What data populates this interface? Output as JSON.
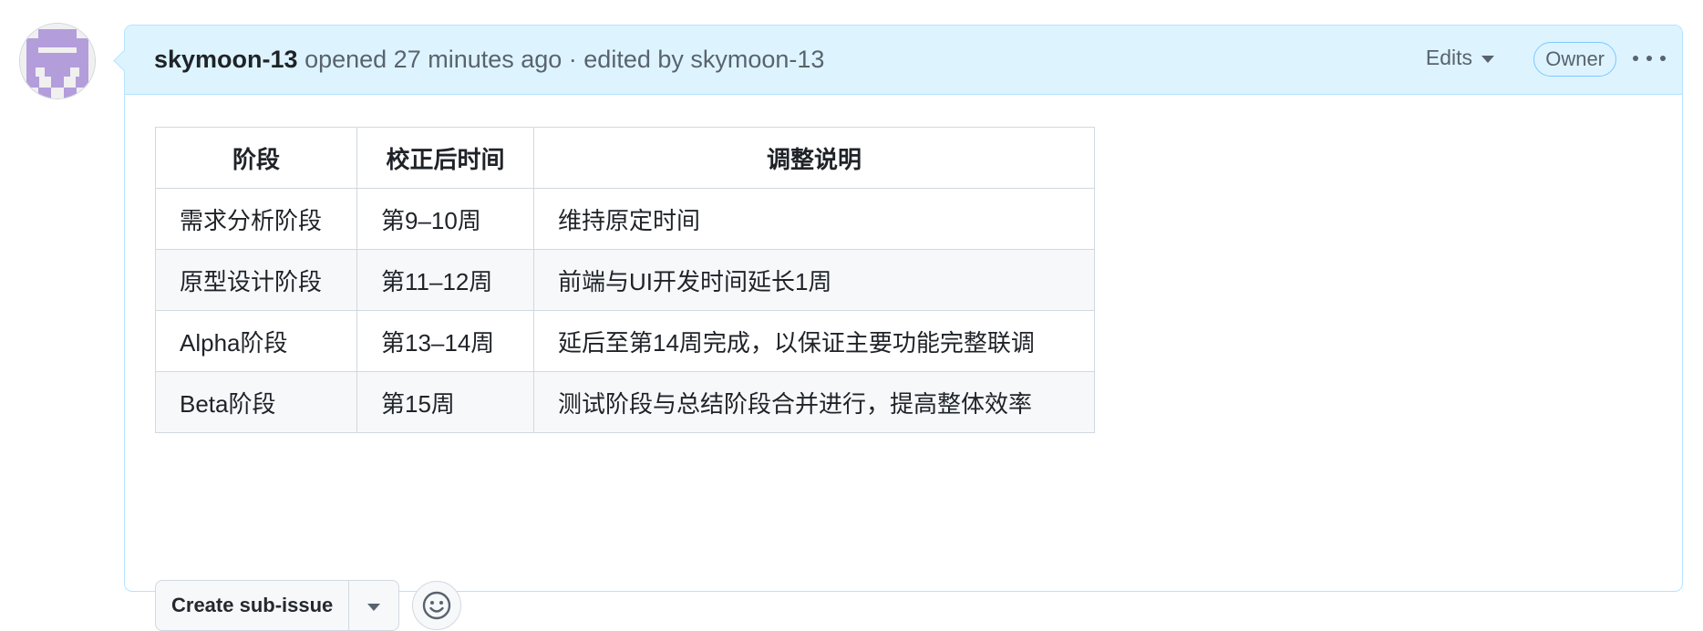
{
  "comment": {
    "author": "skymoon-13",
    "opened_text": "opened 27 minutes ago · edited by skymoon-13",
    "edits_label": "Edits",
    "owner_badge": "Owner",
    "more_icon": "kebab-horizontal-icon"
  },
  "avatar": {
    "icon": "identicon",
    "color": "#b39ddb"
  },
  "table": {
    "headers": [
      "阶段",
      "校正后时间",
      "调整说明"
    ],
    "rows": [
      [
        "需求分析阶段",
        "第9–10周",
        "维持原定时间"
      ],
      [
        "原型设计阶段",
        "第11–12周",
        "前端与UI开发时间延长1周"
      ],
      [
        "Alpha阶段",
        "第13–14周",
        "延后至第14周完成，以保证主要功能完整联调"
      ],
      [
        "Beta阶段",
        "第15周",
        "测试阶段与总结阶段合并进行，提高整体效率"
      ]
    ]
  },
  "actions": {
    "create_sub_issue": "Create sub-issue",
    "dropdown_icon": "triangle-down-icon",
    "reaction_icon": "smiley-icon"
  },
  "colors": {
    "header_bg": "#ddf4ff",
    "border": "#b6e3ff",
    "stripe": "#f6f8fa"
  }
}
